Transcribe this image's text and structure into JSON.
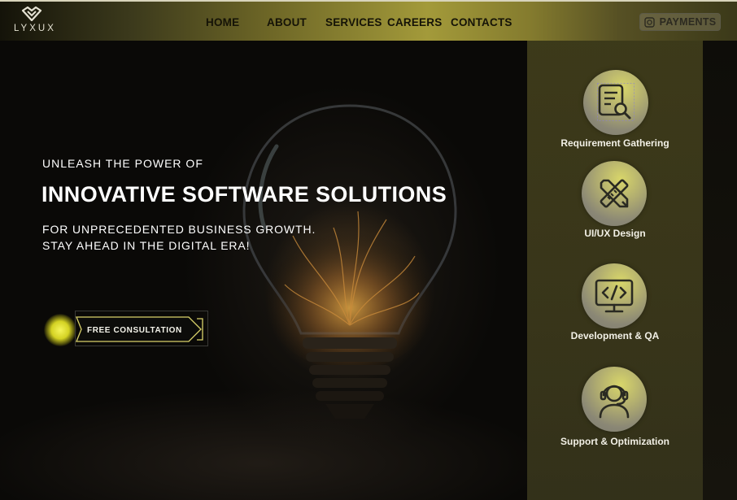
{
  "brand": {
    "logo_text": "LYXUX"
  },
  "nav": {
    "links": [
      "HOME",
      "ABOUT",
      "SERVICES",
      "CAREERS",
      "CONTACTS"
    ],
    "payments_label": "PAYMENTS"
  },
  "hero": {
    "tagline": "UNLEASH THE POWER OF",
    "headline": "INNOVATIVE SOFTWARE SOLUTIONS",
    "subline_1": "FOR UNPRECEDENTED BUSINESS GROWTH.",
    "subline_2": "STAY AHEAD IN THE DIGITAL ERA!",
    "cta_label": "FREE CONSULTATION"
  },
  "services": [
    {
      "label": "Requirement Gathering",
      "icon": "document-search-icon"
    },
    {
      "label": "UI/UX Design",
      "icon": "pencil-ruler-icon"
    },
    {
      "label": "Development & QA",
      "icon": "code-monitor-icon"
    },
    {
      "label": "Support & Optimization",
      "icon": "headset-support-icon"
    }
  ],
  "colors": {
    "accent_gold": "#a39a3a",
    "panel_olive": "#3c391a",
    "cta_glow": "#f5f45a",
    "text_light": "#f2f0e6"
  }
}
